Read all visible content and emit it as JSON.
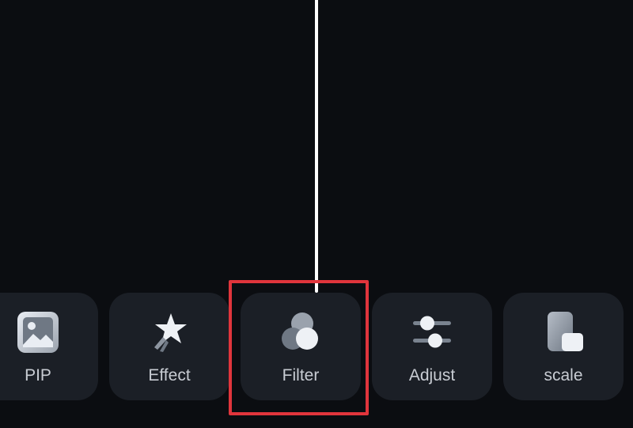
{
  "toolbar": {
    "items": [
      {
        "id": "pip",
        "label": "PIP",
        "icon": "picture-in-picture-icon"
      },
      {
        "id": "effect",
        "label": "Effect",
        "icon": "star-effect-icon"
      },
      {
        "id": "filter",
        "label": "Filter",
        "icon": "filter-circles-icon",
        "highlighted": true
      },
      {
        "id": "adjust",
        "label": "Adjust",
        "icon": "sliders-icon"
      },
      {
        "id": "scale",
        "label": "scale",
        "icon": "scale-rectangles-icon"
      }
    ]
  },
  "colors": {
    "background": "#0b0d11",
    "tile": "#1b1f26",
    "label": "#c8ccd3",
    "highlight": "#e0353c",
    "playhead": "#ffffff"
  }
}
